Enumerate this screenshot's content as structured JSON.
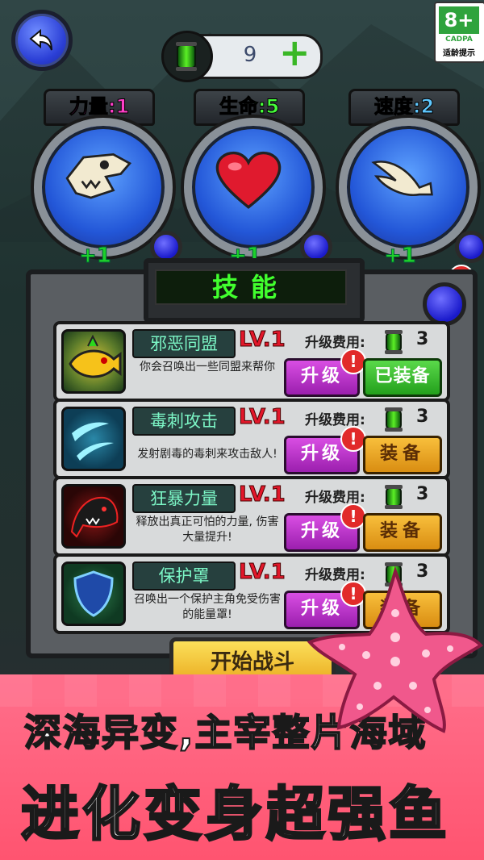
{
  "top": {
    "back_icon": "back-arrow-icon",
    "currency_value": "9",
    "add_icon": "plus-icon",
    "age_rating": {
      "number": "8+",
      "org": "CADPA",
      "note": "适龄提示"
    }
  },
  "stats": [
    {
      "label": "力量:1",
      "label_color": "#ff3ec8",
      "icon": "shark-skull-icon",
      "bonus": "+1",
      "cost": "1"
    },
    {
      "label": "生命:5",
      "label_color": "#46ff3a",
      "icon": "heart-icon",
      "bonus": "+1",
      "cost": "1"
    },
    {
      "label": "速度:2",
      "label_color": "#5fc8ff",
      "icon": "fish-tail-icon",
      "bonus": "+1",
      "cost": "1"
    }
  ],
  "skills_panel": {
    "title": "技能",
    "cost_label": "升级费用:",
    "items": [
      {
        "name": "邪恶同盟",
        "level": "LV.1",
        "cost": "3",
        "desc": "你会召唤出一些同盟来帮你",
        "upgrade": "升级",
        "equip": "已装备",
        "equipped": true
      },
      {
        "name": "毒刺攻击",
        "level": "LV.1",
        "cost": "3",
        "desc": "发射剧毒的毒刺来攻击敌人!",
        "upgrade": "升级",
        "equip": "装备",
        "equipped": false
      },
      {
        "name": "狂暴力量",
        "level": "LV.1",
        "cost": "3",
        "desc": "释放出真正可怕的力量, 伤害大量提升!",
        "upgrade": "升级",
        "equip": "装备",
        "equipped": false
      },
      {
        "name": "保护罩",
        "level": "LV.1",
        "cost": "3",
        "desc": "召唤出一个保护主角免受伤害的能量罩!",
        "upgrade": "升级",
        "equip": "装备",
        "equipped": false
      }
    ]
  },
  "start_button": "开始战斗",
  "promo": {
    "line1": "深海异变,主宰整片海域",
    "line2": "进化变身超强鱼"
  },
  "colors": {
    "accent_green": "#41ff2e",
    "level_red": "#e2172a",
    "banner_pink": "#ff5470"
  }
}
